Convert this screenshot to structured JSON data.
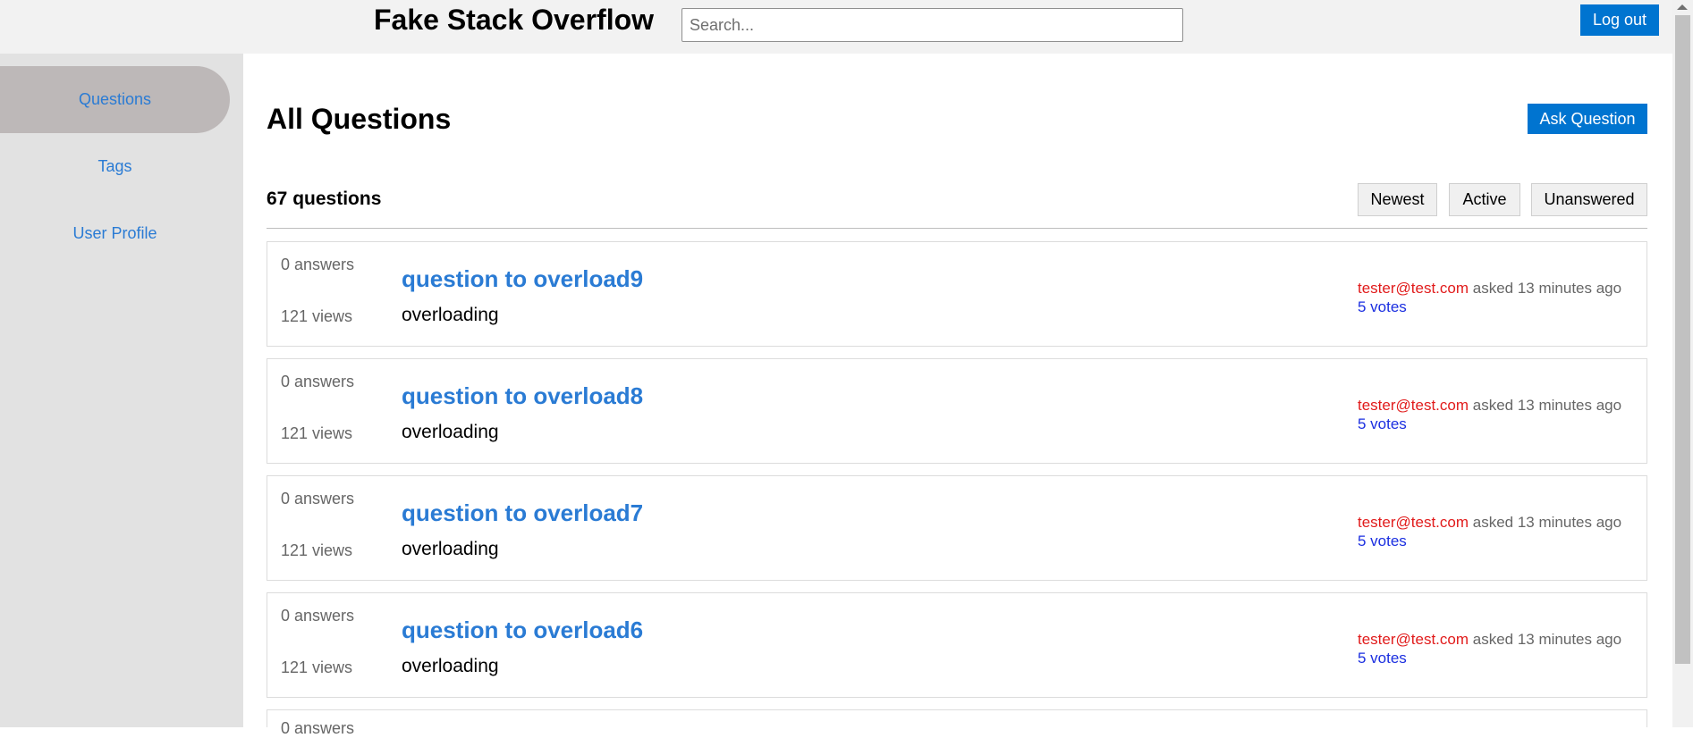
{
  "header": {
    "title": "Fake Stack Overflow",
    "search_placeholder": "Search...",
    "logout_label": "Log out"
  },
  "sidebar": {
    "items": [
      {
        "label": "Questions",
        "active": true
      },
      {
        "label": "Tags",
        "active": false
      },
      {
        "label": "User Profile",
        "active": false
      }
    ]
  },
  "main": {
    "title": "All Questions",
    "ask_label": "Ask Question",
    "count_text": "67 questions",
    "filters": [
      "Newest",
      "Active",
      "Unanswered"
    ],
    "questions": [
      {
        "answers": "0 answers",
        "views": "121 views",
        "title": "question to overload9",
        "tag": "overloading",
        "user": "tester@test.com",
        "asked": "asked 13 minutes ago",
        "votes": "5 votes"
      },
      {
        "answers": "0 answers",
        "views": "121 views",
        "title": "question to overload8",
        "tag": "overloading",
        "user": "tester@test.com",
        "asked": "asked 13 minutes ago",
        "votes": "5 votes"
      },
      {
        "answers": "0 answers",
        "views": "121 views",
        "title": "question to overload7",
        "tag": "overloading",
        "user": "tester@test.com",
        "asked": "asked 13 minutes ago",
        "votes": "5 votes"
      },
      {
        "answers": "0 answers",
        "views": "121 views",
        "title": "question to overload6",
        "tag": "overloading",
        "user": "tester@test.com",
        "asked": "asked 13 minutes ago",
        "votes": "5 votes"
      },
      {
        "answers": "0 answers",
        "views": "",
        "title": "",
        "tag": "",
        "user": "",
        "asked": "",
        "votes": ""
      }
    ]
  },
  "colors": {
    "accent": "#0074d0",
    "link": "#2a7bd4",
    "user": "#e11b1b",
    "votes": "#1a2ee0"
  }
}
